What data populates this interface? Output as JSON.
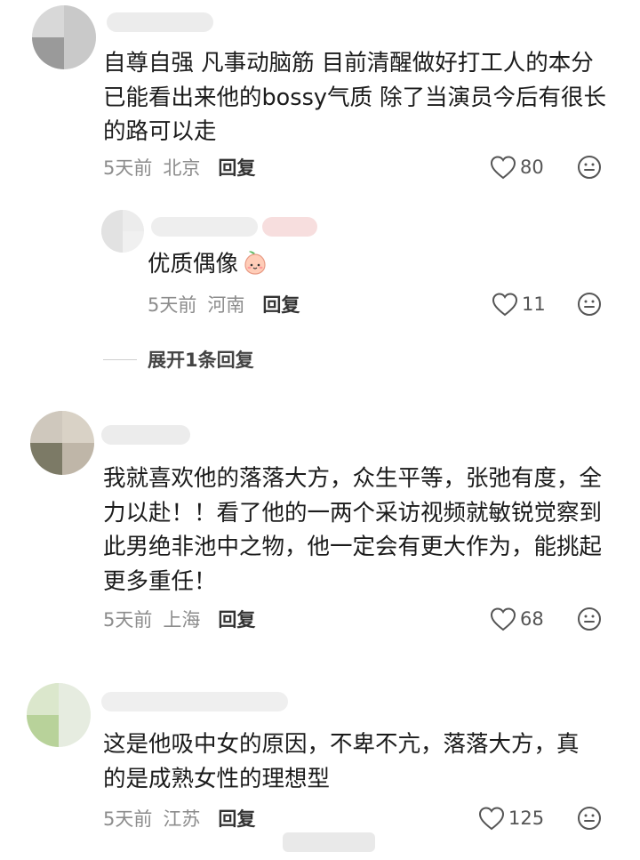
{
  "comments": [
    {
      "text": "自尊自强 凡事动脑筋 目前清醒做好打工人的本分 已能看出来他的bossy气质 除了当演员今后有很长的路可以走",
      "time": "5天前",
      "location": "北京",
      "reply_label": "回复",
      "likes": "80"
    },
    {
      "text": "我就喜欢他的落落大方，众生平等，张弛有度，全力以赴！！看了他的一两个采访视频就敏锐觉察到此男绝非池中之物，他一定会有更大作为，能挑起更多重任！",
      "time": "5天前",
      "location": "上海",
      "reply_label": "回复",
      "likes": "68"
    },
    {
      "text": "这是他吸中女的原因，不卑不亢，落落大方，真的是成熟女性的理想型",
      "time": "5天前",
      "location": "江苏",
      "reply_label": "回复",
      "likes": "125"
    }
  ],
  "reply": {
    "text": "优质偶像",
    "time": "5天前",
    "location": "河南",
    "reply_label": "回复",
    "likes": "11"
  },
  "expand_label": "展开1条回复",
  "icons": {
    "like": "heart-outline-icon",
    "more": "smiley-face-icon",
    "emoji": "peach-emoji-icon"
  },
  "colors": {
    "meta_gray": "#8c8c8c",
    "text": "#1b1b1b"
  }
}
